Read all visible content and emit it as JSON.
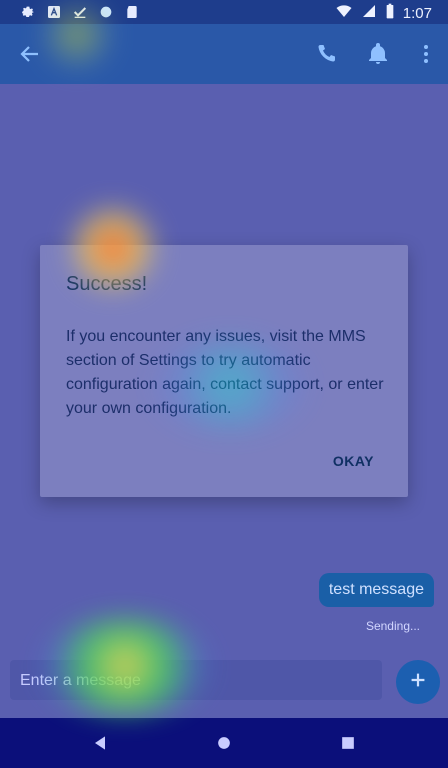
{
  "statusbar": {
    "time": "1:07",
    "left_icons": [
      "gear-icon",
      "a-icon",
      "check-icon",
      "circle-icon",
      "sd-card-icon"
    ],
    "right_icons": [
      "wifi-icon",
      "signal-icon",
      "battery-icon"
    ]
  },
  "appbar": {
    "back_icon": "arrow-left-icon",
    "actions": [
      "phone-icon",
      "bell-icon",
      "more-vert-icon"
    ]
  },
  "conversation": {
    "outgoing_message": "test message",
    "status": "Sending..."
  },
  "compose": {
    "placeholder": "Enter a message",
    "send_icon": "plus-icon"
  },
  "dialog": {
    "title": "Success!",
    "body": "If you encounter any issues, visit the MMS section of Settings to try automatic configuration again, contact support, or enter your own configuration.",
    "button": "OKAY"
  },
  "colors": {
    "appbar": "#2a58a8",
    "statusbar": "#1e3d8c",
    "navbar": "#0b0f7a",
    "dialog": "#7c7fbf",
    "bubble": "#1a5fa7"
  }
}
